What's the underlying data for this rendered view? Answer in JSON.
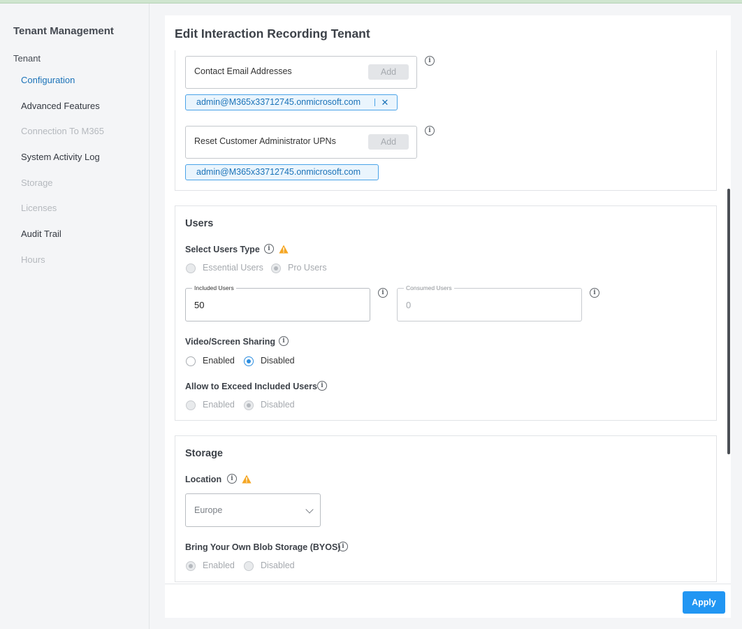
{
  "sidebar": {
    "title": "Tenant Management",
    "section": "Tenant",
    "items": [
      {
        "label": "Configuration",
        "state": "active"
      },
      {
        "label": "Advanced Features",
        "state": "normal"
      },
      {
        "label": "Connection To M365",
        "state": "disabled"
      },
      {
        "label": "System Activity Log",
        "state": "normal"
      },
      {
        "label": "Storage",
        "state": "disabled"
      },
      {
        "label": "Licenses",
        "state": "disabled"
      },
      {
        "label": "Audit Trail",
        "state": "normal"
      },
      {
        "label": "Hours",
        "state": "disabled"
      }
    ]
  },
  "page": {
    "title": "Edit Interaction Recording Tenant",
    "info_glyph": "i"
  },
  "contacts": {
    "email_label": "Contact Email Addresses",
    "email_add": "Add",
    "email_chip": "admin@M365x33712745.onmicrosoft.com",
    "chip_close": "✕",
    "reset_label": "Reset Customer Administrator UPNs",
    "reset_add": "Add",
    "reset_chip": "admin@M365x33712745.onmicrosoft.com"
  },
  "users": {
    "title": "Users",
    "type_label": "Select Users Type",
    "type_options": [
      "Essential Users",
      "Pro Users"
    ],
    "type_selected": "Pro Users",
    "included_label": "Included Users",
    "included_value": "50",
    "consumed_label": "Consumed Users",
    "consumed_value": "0",
    "video_label": "Video/Screen Sharing",
    "video_options": [
      "Enabled",
      "Disabled"
    ],
    "video_selected": "Disabled",
    "exceed_label": "Allow to Exceed Included Users",
    "exceed_options": [
      "Enabled",
      "Disabled"
    ],
    "exceed_selected": "Disabled"
  },
  "storage": {
    "title": "Storage",
    "location_label": "Location",
    "location_value": "Europe",
    "byos_label": "Bring Your Own Blob Storage (BYOS)",
    "byos_options": [
      "Enabled",
      "Disabled"
    ],
    "byos_selected": "Enabled"
  },
  "footer": {
    "apply_label": "Apply"
  },
  "colors": {
    "accent": "#2196f3",
    "link_active": "#1a72b8",
    "warning": "#f5a623"
  },
  "icons": [
    "info-icon",
    "warning-icon",
    "close-icon",
    "chevron-down-icon"
  ]
}
